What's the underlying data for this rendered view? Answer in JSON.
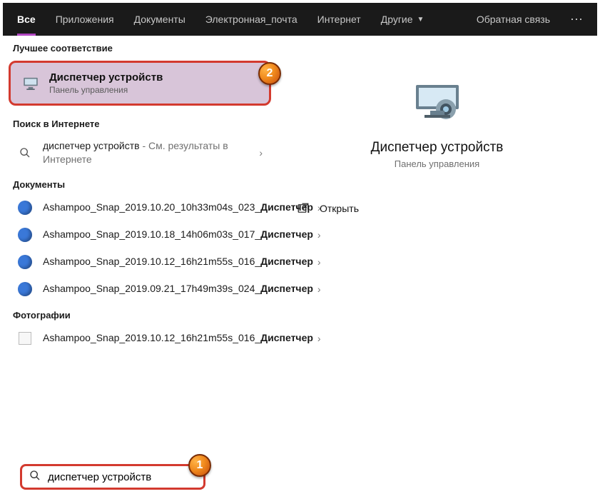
{
  "topbar": {
    "tabs": [
      "Все",
      "Приложения",
      "Документы",
      "Электронная_почта",
      "Интернет",
      "Другие"
    ],
    "feedback": "Обратная связь",
    "more": "⋯"
  },
  "callouts": {
    "one": "1",
    "two": "2"
  },
  "left": {
    "best_match_header": "Лучшее соответствие",
    "best_match": {
      "title": "Диспетчер устройств",
      "subtitle": "Панель управления"
    },
    "web_header": "Поиск в Интернете",
    "web_item": {
      "prefix": "диспетчер устройств",
      "suffix": " - См. результаты в Интернете"
    },
    "docs_header": "Документы",
    "docs": [
      {
        "a": "Ashampoo_Snap_2019.10.20_10h33m04s_023_",
        "b": "Диспетчер"
      },
      {
        "a": "Ashampoo_Snap_2019.10.18_14h06m03s_017_",
        "b": "Диспетчер"
      },
      {
        "a": "Ashampoo_Snap_2019.10.12_16h21m55s_016_",
        "b": "Диспетчер"
      },
      {
        "a": "Ashampoo_Snap_2019.09.21_17h49m39s_024_",
        "b": "Диспетчер"
      }
    ],
    "photos_header": "Фотографии",
    "photos": [
      {
        "a": "Ashampoo_Snap_2019.10.12_16h21m55s_016_",
        "b": "Диспетчер"
      }
    ]
  },
  "right": {
    "title": "Диспетчер устройств",
    "subtitle": "Панель управления",
    "open": "Открыть"
  },
  "search": {
    "value": "диспетчер устройств"
  }
}
